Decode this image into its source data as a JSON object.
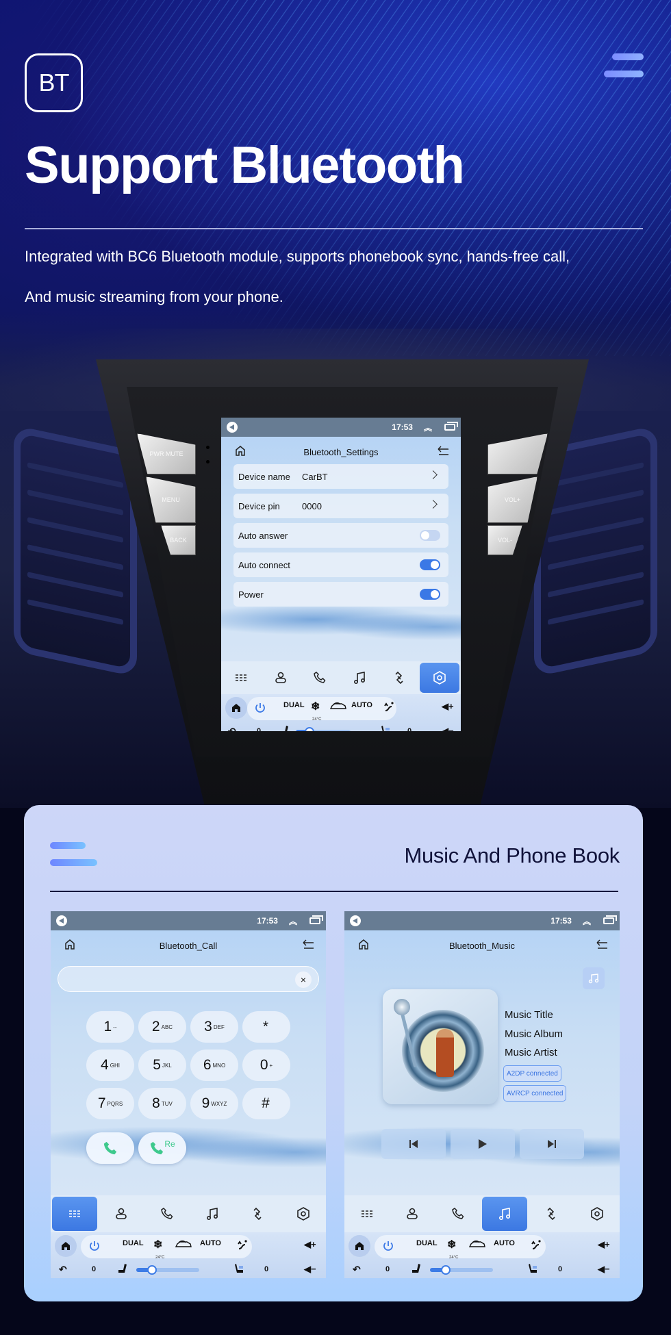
{
  "hero": {
    "badge": "BT",
    "title": "Support Bluetooth",
    "description_line1": "Integrated with BC6 Bluetooth module, supports phonebook sync, hands-free call,",
    "description_line2": "And music streaming from your phone.",
    "menu_icon": "hamburger-icon",
    "accent_color": "#7c8cff"
  },
  "hardware_buttons": {
    "left": [
      "PWR MUTE",
      "MENU",
      "BACK"
    ],
    "right": [
      "",
      "VOL+",
      "VOL-"
    ]
  },
  "status_bar": {
    "time": "17:53",
    "icons": [
      "volume-icon",
      "chevron-up-double-icon",
      "recent-apps-icon"
    ]
  },
  "settings_screen": {
    "title": "Bluetooth_Settings",
    "rows": [
      {
        "label": "Device name",
        "value": "CarBT",
        "type": "link"
      },
      {
        "label": "Device pin",
        "value": "0000",
        "type": "link"
      },
      {
        "label": "Auto answer",
        "type": "toggle",
        "on": false
      },
      {
        "label": "Auto connect",
        "type": "toggle",
        "on": true
      },
      {
        "label": "Power",
        "type": "toggle",
        "on": true
      }
    ],
    "active_tab": "settings"
  },
  "nav_tabs": [
    "dialpad",
    "contacts",
    "call-log",
    "music",
    "link",
    "settings"
  ],
  "climate": {
    "mode_dual": "DUAL",
    "mode_auto": "AUTO",
    "temperature": "24°C",
    "left_seat_value": "0",
    "right_seat_value": "0",
    "fan_level": 0.25
  },
  "feature_card": {
    "title": "Music And Phone Book"
  },
  "call_screen": {
    "title": "Bluetooth_Call",
    "input_value": "",
    "clear_icon": "×",
    "keys": [
      {
        "digit": "1",
        "sub": "--"
      },
      {
        "digit": "2",
        "sub": "ABC"
      },
      {
        "digit": "3",
        "sub": "DEF"
      },
      {
        "digit": "*",
        "sub": ""
      },
      {
        "digit": "4",
        "sub": "GHI"
      },
      {
        "digit": "5",
        "sub": "JKL"
      },
      {
        "digit": "6",
        "sub": "MNO"
      },
      {
        "digit": "0",
        "sub": "+"
      },
      {
        "digit": "7",
        "sub": "PQRS"
      },
      {
        "digit": "8",
        "sub": "TUV"
      },
      {
        "digit": "9",
        "sub": "WXYZ"
      },
      {
        "digit": "#",
        "sub": ""
      }
    ],
    "redial_label": "Re",
    "call_color": "#3ec98d",
    "active_tab": "dialpad"
  },
  "music_screen": {
    "title": "Bluetooth_Music",
    "track_title": "Music Title",
    "album": "Music Album",
    "artist": "Music Artist",
    "badges": [
      "A2DP  connected",
      "AVRCP connected"
    ],
    "active_tab": "music"
  }
}
